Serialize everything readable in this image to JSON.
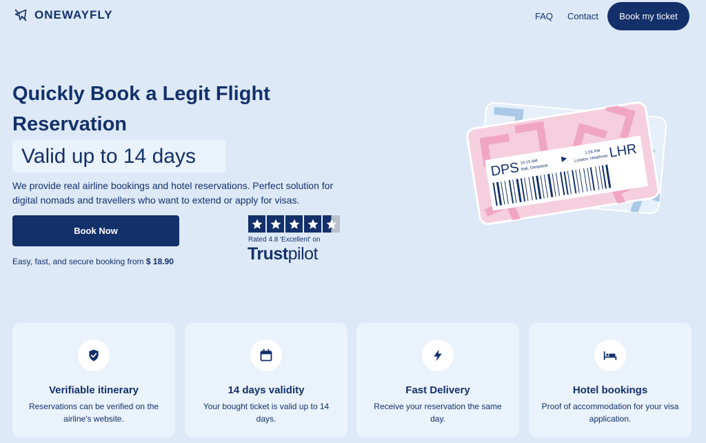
{
  "header": {
    "brand": "ONEWAYFLY",
    "nav": [
      {
        "label": "FAQ"
      },
      {
        "label": "Contact"
      }
    ],
    "cta_label": "Book my ticket"
  },
  "hero": {
    "title": "Quickly Book a Legit Flight Reservation",
    "highlight": "Valid up to 14 days",
    "description": "We provide real airline bookings and hotel reservations. Perfect solution for digital nomads and travellers who want to extend or apply for visas.",
    "book_label": "Book Now",
    "price_prefix": "Easy, fast, and secure booking from",
    "price": "$ 18.90"
  },
  "trustpilot": {
    "rating_text": "Rated 4.8 'Excellent' on",
    "brand_bold": "Trust",
    "brand_light": "pilot",
    "rating": 4.8,
    "stars_total": 5
  },
  "ticket": {
    "from_code": "DPS",
    "from_time": "10:15 AM",
    "from_city": "Bali, Denpasar",
    "to_time": "1:05 PM",
    "to_city": "London, Heathrow",
    "to_code": "LHR"
  },
  "features": [
    {
      "icon": "shield-check-icon",
      "title": "Verifiable itinerary",
      "text": "Reservations can be verified on the airline's website."
    },
    {
      "icon": "calendar-icon",
      "title": "14 days validity",
      "text": "Your bought ticket is valid up to 14 days."
    },
    {
      "icon": "lightning-icon",
      "title": "Fast Delivery",
      "text": "Receive your reservation the same day."
    },
    {
      "icon": "bed-icon",
      "title": "Hotel bookings",
      "text": "Proof of accommodation for your visa application."
    }
  ],
  "colors": {
    "background": "#dde9f7",
    "navy": "#13306a",
    "card": "#eaf2fb",
    "ticket_pink": "#f6cfdf"
  }
}
